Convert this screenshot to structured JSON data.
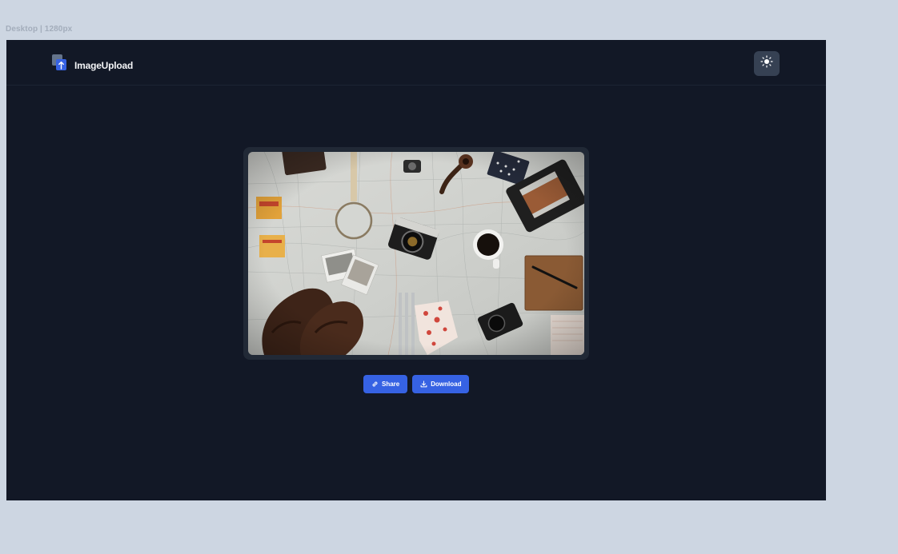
{
  "frame_label": "Desktop | 1280px",
  "app": {
    "brand_name": "ImageUpload",
    "theme_toggle_icon": "sun-icon",
    "image_alt": "Flat lay of travel items on a map: vintage cameras, boots, magnifying glass, pipe, coffee cup and notebook",
    "actions": {
      "share_label": "Share",
      "share_icon": "link-icon",
      "download_label": "Download",
      "download_icon": "download-icon"
    }
  },
  "colors": {
    "page_background": "#cdd6e2",
    "app_background": "#121826",
    "card_background": "#212936",
    "accent": "#3662e3",
    "toggle_background": "#364153"
  }
}
